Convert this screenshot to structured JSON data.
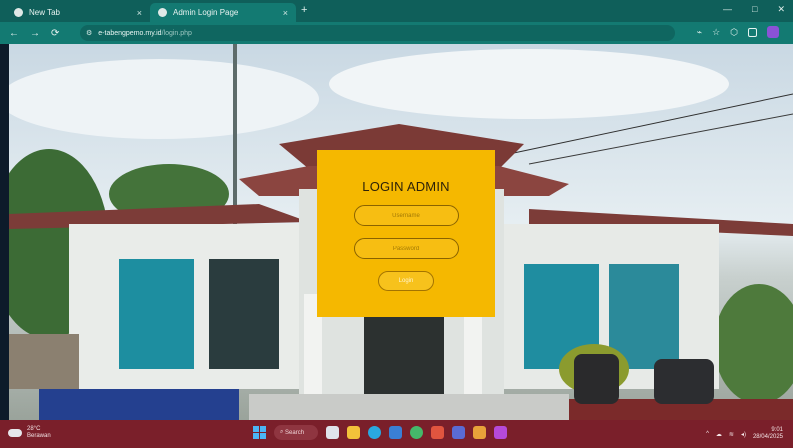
{
  "browser": {
    "tabs": [
      {
        "label": "New Tab",
        "active": false
      },
      {
        "label": "Admin Login Page",
        "active": true
      }
    ],
    "new_tab_glyph": "+",
    "close_glyph": "×",
    "window_controls": [
      "—",
      "□",
      "✕"
    ],
    "address": {
      "host": "e-tabengpemo.my.id",
      "path": "/login.php"
    },
    "toolbar_icons": [
      "cast-icon",
      "star-icon",
      "extensions-icon",
      "sidebar-icon",
      "profile-icon"
    ]
  },
  "login": {
    "title": "LOGIN ADMIN",
    "username_placeholder": "Username",
    "password_placeholder": "Password",
    "button_label": "Login"
  },
  "taskbar": {
    "weather_temp": "28°C",
    "weather_desc": "Berawan",
    "search_label": "Search",
    "apps": [
      "task-view",
      "file-explorer",
      "edge",
      "store",
      "chrome",
      "photos",
      "teams",
      "paint",
      "settings"
    ],
    "time": "9:01",
    "date": "28/04/2025"
  },
  "colors": {
    "browser_frame": "#0f5f5a",
    "browser_toolbar": "#137a72",
    "login_card": "#f5b800",
    "taskbar": "#7a1f2a"
  }
}
